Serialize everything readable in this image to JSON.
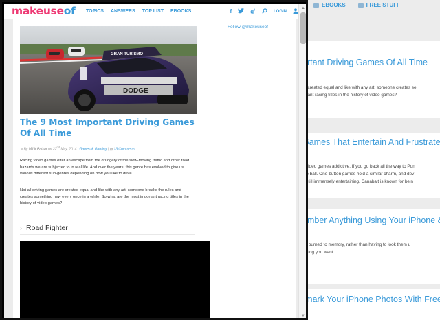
{
  "background_page": {
    "top_nav": [
      {
        "icon": "ebooks-icon",
        "label": "EBOOKS"
      },
      {
        "icon": "free-stuff-icon",
        "label": "FREE STUFF"
      }
    ],
    "cards": [
      {
        "title": "ortant Driving Games Of All Time",
        "snippet": [
          "re created equal and like with any art, someone creates se",
          "ortant racing titles in the history of video games?"
        ]
      },
      {
        "title": "Games That Entertain And Frustrate",
        "snippet": [
          "s video games addictive. If you go back all the way to Pon",
          "the ball. One-button games hold a similar charm, and dev",
          "e still immensely entertaining. Canabalt is known for bein"
        ]
      },
      {
        "title": "ember Anything Using Your iPhone & i",
        "snippet": [
          "off burned to memory, rather than having to look them u",
          "ything you want."
        ]
      },
      {
        "title": "rmark Your iPhone Photos With Free",
        "snippet": []
      }
    ]
  },
  "header": {
    "logo_a": "makeuse",
    "logo_b": "of",
    "nav": [
      "TOPICS",
      "ANSWERS",
      "TOP LIST",
      "EBOOKS"
    ],
    "tools": {
      "facebook": "f",
      "twitter": "•",
      "google": "8⁺",
      "search": "⌕",
      "login": "LOGIN",
      "user": "☺"
    }
  },
  "sidebar": {
    "follow": "Follow @makeuseof"
  },
  "article": {
    "hero_alt": "Dodge Challenger racing car on track",
    "hero_car_text": "DODGE",
    "hero_hood_text": "GRAN TURISMO",
    "title": "The 9 Most Important Driving Games Of All Time",
    "meta": {
      "by": "By",
      "author": "Mihir Patkar",
      "on": "on 22",
      "sup": "nd",
      "date_rest": "May, 2014 |",
      "category": "Games & Gaming",
      "sep": "|",
      "comments": "13 Comments"
    },
    "paragraphs": [
      "Racing video games offer an escape from the drudgery of the slow-moving traffic and other road hazards we are subjected to in real life. And over the years, this genre has evolved to give us various different sub-genres depending on how you like to drive.",
      "Not all driving games are created equal and like with any art, someone breaks the rules and creates something new every once in a while. So what are the most important racing titles in the history of video games?"
    ],
    "subheading": "Road Fighter",
    "subheading_chevron": "›"
  },
  "colors": {
    "accent": "#3a9ad9",
    "logo_pink": "#ee3a74",
    "text": "#333333"
  }
}
